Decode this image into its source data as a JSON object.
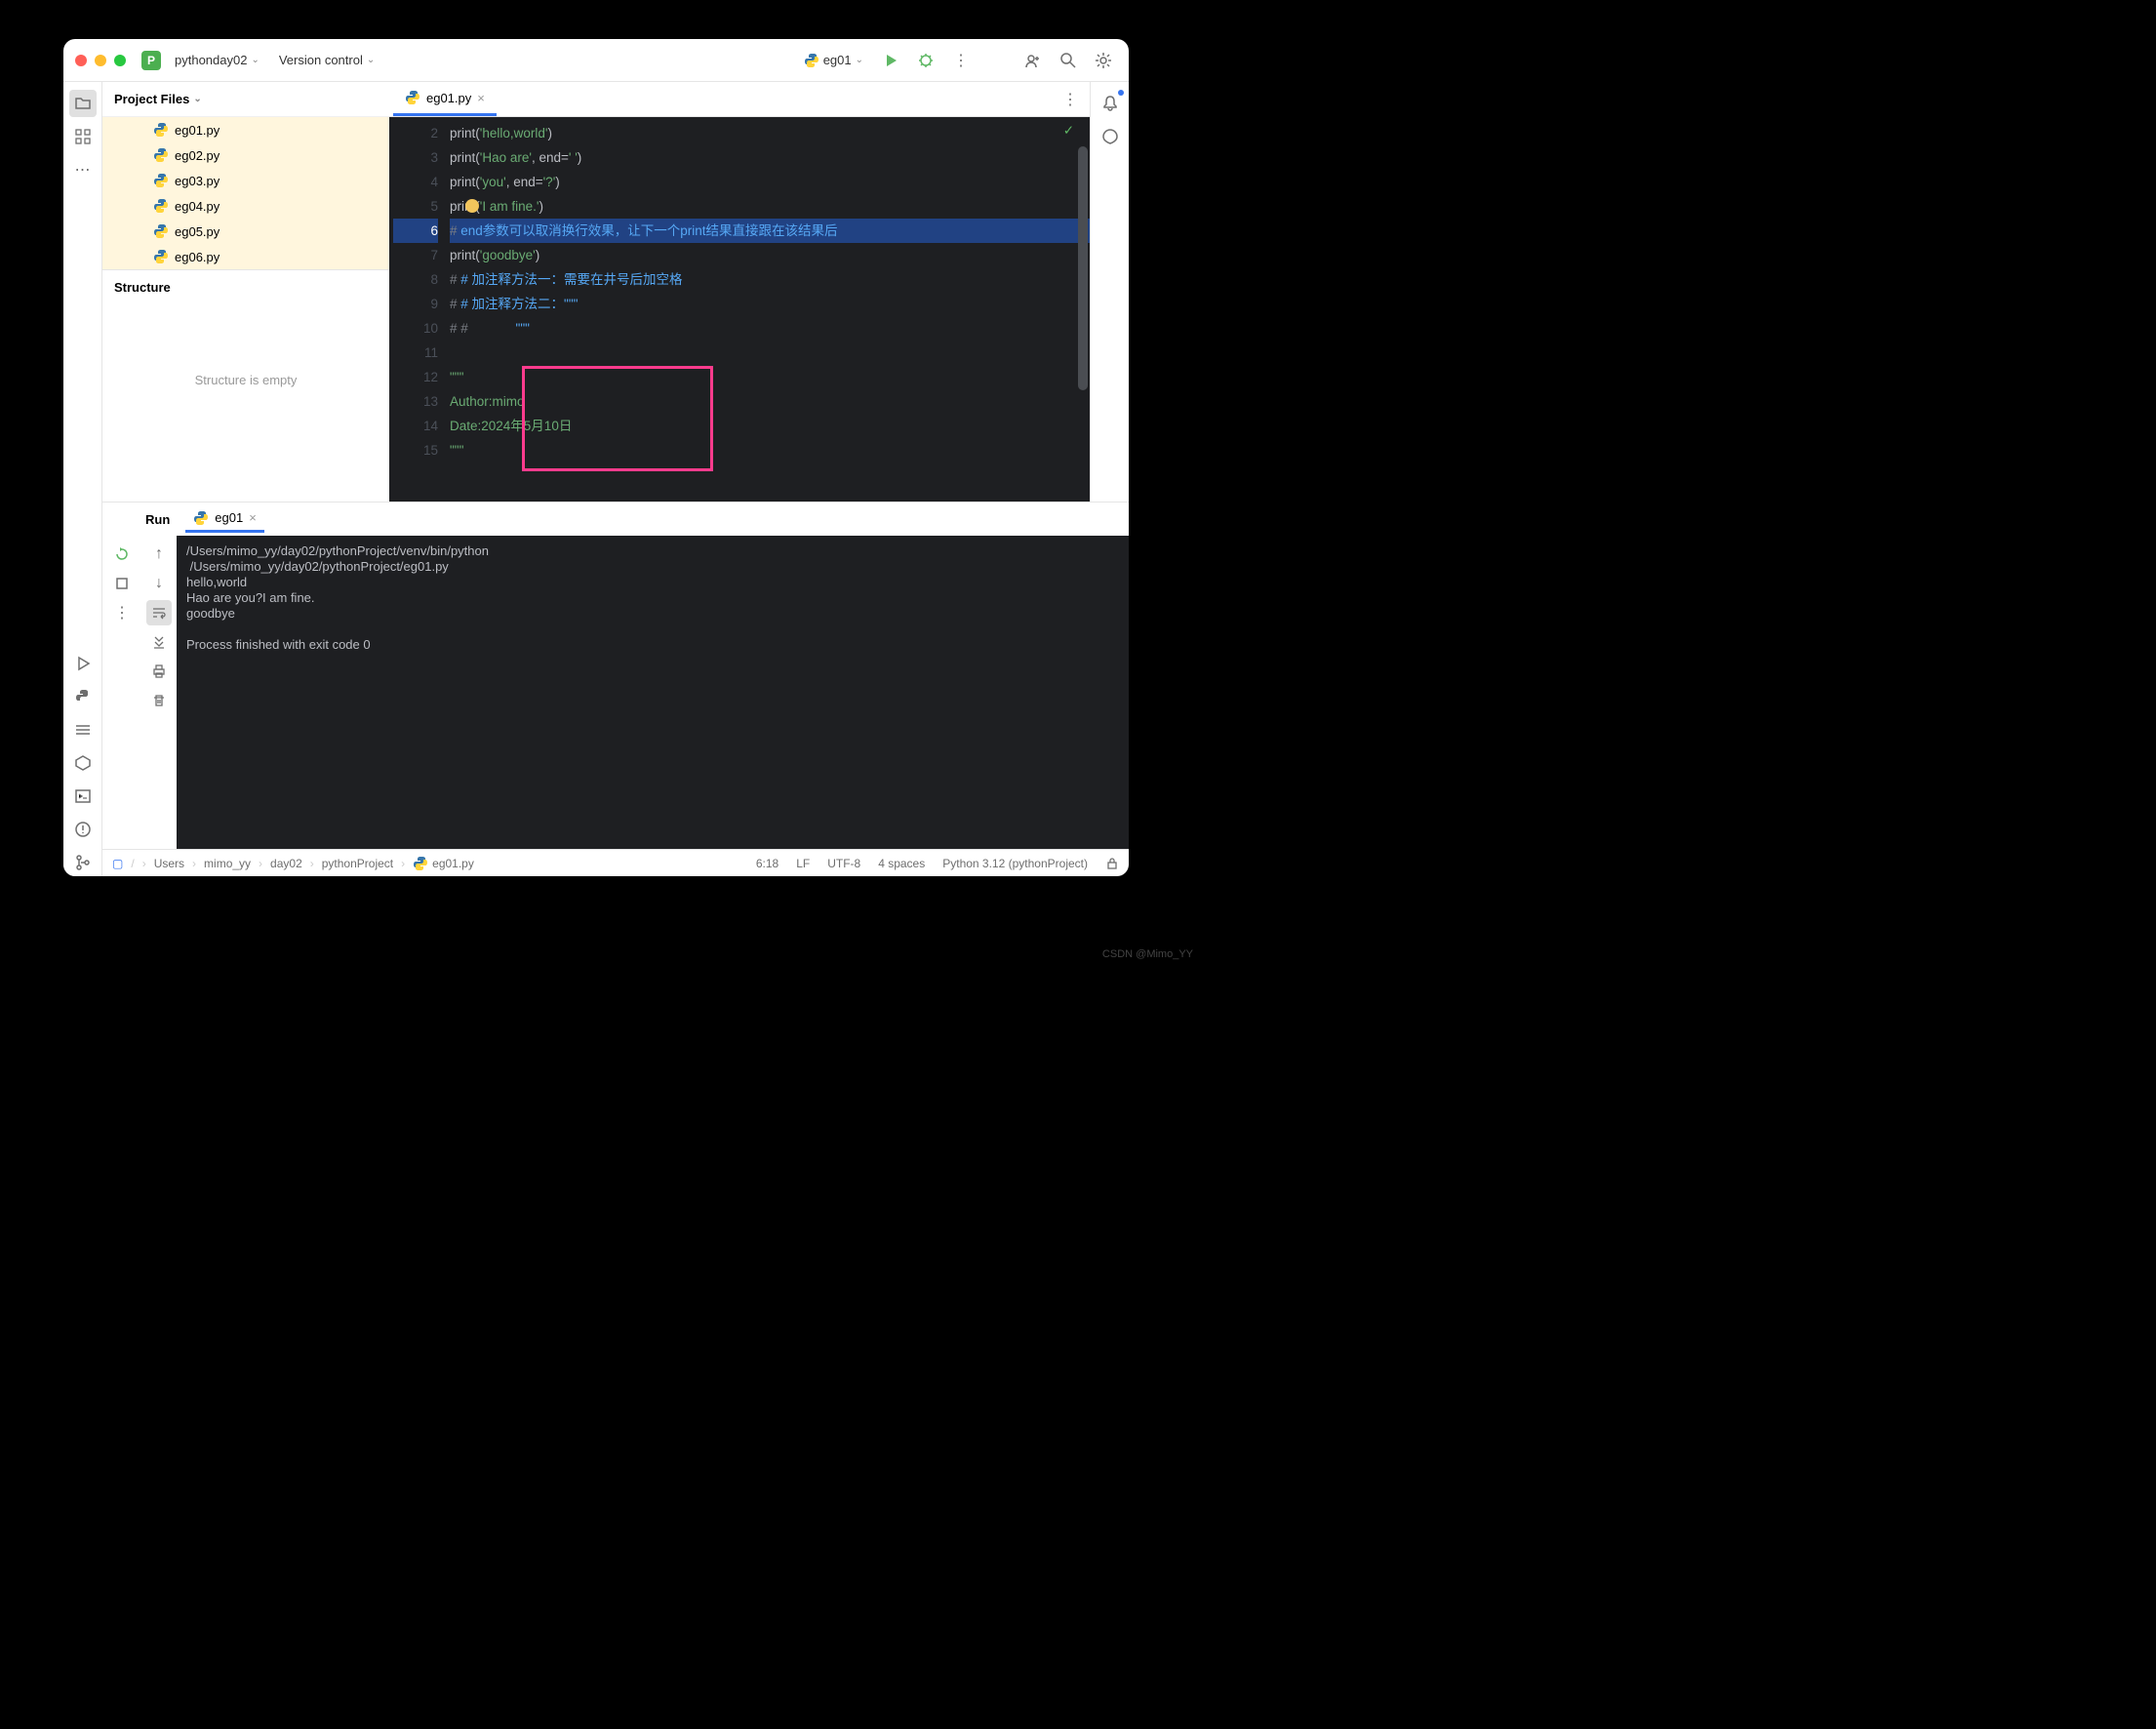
{
  "titlebar": {
    "project_name": "pythonday02",
    "version_control": "Version control",
    "run_config": "eg01"
  },
  "project_panel": {
    "header": "Project Files",
    "files": [
      "eg01.py",
      "eg02.py",
      "eg03.py",
      "eg04.py",
      "eg05.py",
      "eg06.py"
    ],
    "structure_label": "Structure",
    "structure_empty": "Structure is empty"
  },
  "editor": {
    "tab": "eg01.py",
    "lines": [
      {
        "n": 2,
        "html": "<span class='s-def'>print(</span><span class='s-str'>'hello,world'</span><span class='s-def'>)</span>"
      },
      {
        "n": 3,
        "html": "<span class='s-def'>print(</span><span class='s-str'>'Hao are'</span><span class='s-def'>, end=</span><span class='s-str'>' '</span><span class='s-def'>)</span>"
      },
      {
        "n": 4,
        "html": "<span class='s-def'>print(</span><span class='s-str'>'you'</span><span class='s-def'>, end=</span><span class='s-str'>'?'</span><span class='s-def'>)</span>"
      },
      {
        "n": 5,
        "html": "<span class='s-def'>print(</span><span class='s-str'>'I am fine.'</span><span class='s-def'>)</span>"
      },
      {
        "n": 6,
        "hl": true,
        "html": "<span class='s-comm'># </span><span class='s-zh'>end参数可以取消换行效果，让下一个print结果直接跟在该结果后</span>"
      },
      {
        "n": 7,
        "html": "<span class='s-def'>print(</span><span class='s-str'>'goodbye'</span><span class='s-def'>)</span>"
      },
      {
        "n": 8,
        "html": "<span class='s-comm'># </span><span class='s-zh'># 加注释方法一：需要在井号后加空格</span>"
      },
      {
        "n": 9,
        "html": "<span class='s-comm'># </span><span class='s-zh'># 加注释方法二：\"\"\"</span>"
      },
      {
        "n": 10,
        "html": "<span class='s-comm'># #             </span><span class='s-zh'>\"\"\"</span>"
      },
      {
        "n": 11,
        "html": ""
      },
      {
        "n": 12,
        "html": "<span class='s-str'>\"\"\"</span>"
      },
      {
        "n": 13,
        "html": "<span class='s-str'>Author:mimo</span>"
      },
      {
        "n": 14,
        "html": "<span class='s-str'>Date:2024年5月10日</span>"
      },
      {
        "n": 15,
        "html": "<span class='s-str'>\"\"\"</span>"
      }
    ]
  },
  "run": {
    "label": "Run",
    "tab": "eg01",
    "output": "/Users/mimo_yy/day02/pythonProject/venv/bin/python \n /Users/mimo_yy/day02/pythonProject/eg01.py \nhello,world\nHao are you?I am fine.\ngoodbye\n\nProcess finished with exit code 0"
  },
  "statusbar": {
    "crumbs": [
      "Users",
      "mimo_yy",
      "day02",
      "pythonProject",
      "eg01.py"
    ],
    "pos": "6:18",
    "lf": "LF",
    "enc": "UTF-8",
    "indent": "4 spaces",
    "interp": "Python 3.12 (pythonProject)"
  },
  "watermark": "CSDN @Mimo_YY"
}
